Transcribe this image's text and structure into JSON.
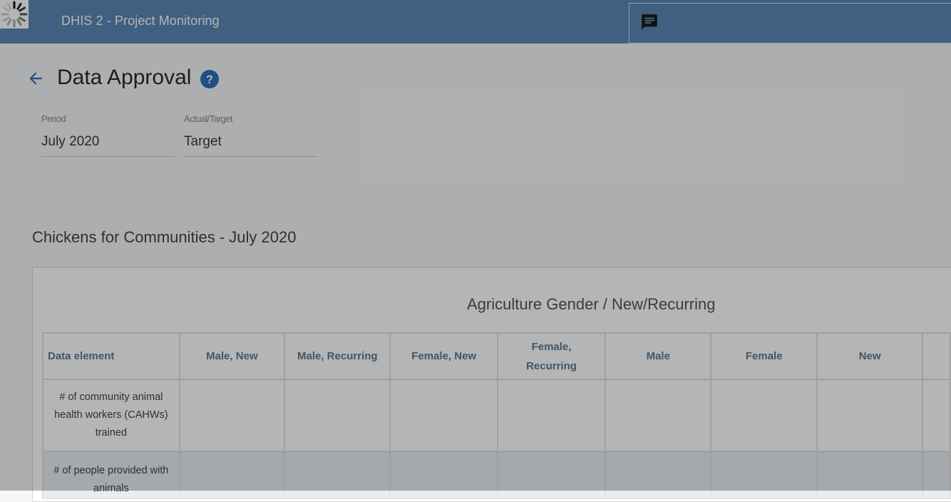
{
  "header": {
    "app_title": "DHIS 2 - Project Monitoring",
    "messages_icon": "chat-message-icon",
    "loading_icon": "loading-spinner-icon"
  },
  "page": {
    "title": "Data Approval",
    "back_icon": "arrow-back-icon",
    "help_icon": "help-circle-icon"
  },
  "filters": {
    "period": {
      "label": "Period",
      "value": "July 2020"
    },
    "actual_target": {
      "label": "Actual/Target",
      "value": "Target"
    }
  },
  "section": {
    "title": "Chickens for Communities - July 2020",
    "table_title": "Agriculture Gender / New/Recurring",
    "columns": [
      "Data element",
      "Male, New",
      "Male, Recurring",
      "Female, New",
      "Female, Recurring",
      "Male",
      "Female",
      "New"
    ],
    "rows": [
      {
        "label": "# of community animal health workers (CAHWs) trained"
      },
      {
        "label": "# of people provided with animals"
      }
    ]
  },
  "colors": {
    "header_bg": "#5a88b5",
    "accent": "#2d6fb8",
    "overlay": "rgba(0,0,0,0.29)"
  }
}
